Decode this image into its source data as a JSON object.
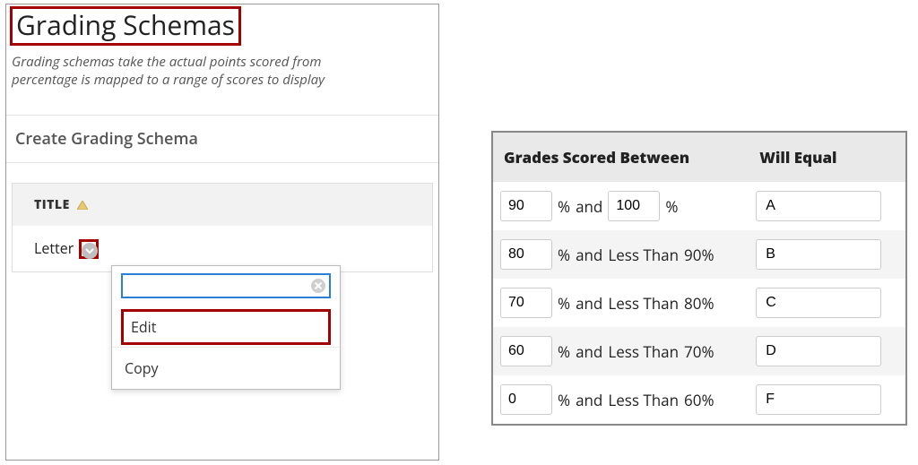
{
  "page": {
    "title": "Grading Schemas",
    "intro_line1": "Grading schemas take the actual points scored from",
    "intro_line2": "percentage is mapped to a range of scores to display"
  },
  "toolbar": {
    "create_label": "Create Grading Schema"
  },
  "list": {
    "title_header": "TITLE",
    "items": [
      {
        "label": "Letter"
      }
    ]
  },
  "dropdown": {
    "search_value": "",
    "edit_label": "Edit",
    "copy_label": "Copy"
  },
  "table": {
    "col_between": "Grades Scored Between",
    "col_equal": "Will Equal",
    "pct": "%",
    "and": "and",
    "less_than": "Less Than",
    "rows": [
      {
        "low": "90",
        "high": "100",
        "high_is_value": true,
        "grade": "A"
      },
      {
        "low": "80",
        "high": "90%",
        "high_is_value": false,
        "grade": "B"
      },
      {
        "low": "70",
        "high": "80%",
        "high_is_value": false,
        "grade": "C"
      },
      {
        "low": "60",
        "high": "70%",
        "high_is_value": false,
        "grade": "D"
      },
      {
        "low": "0",
        "high": "60%",
        "high_is_value": false,
        "grade": "F"
      }
    ]
  },
  "colors": {
    "highlight": "#a30000"
  }
}
